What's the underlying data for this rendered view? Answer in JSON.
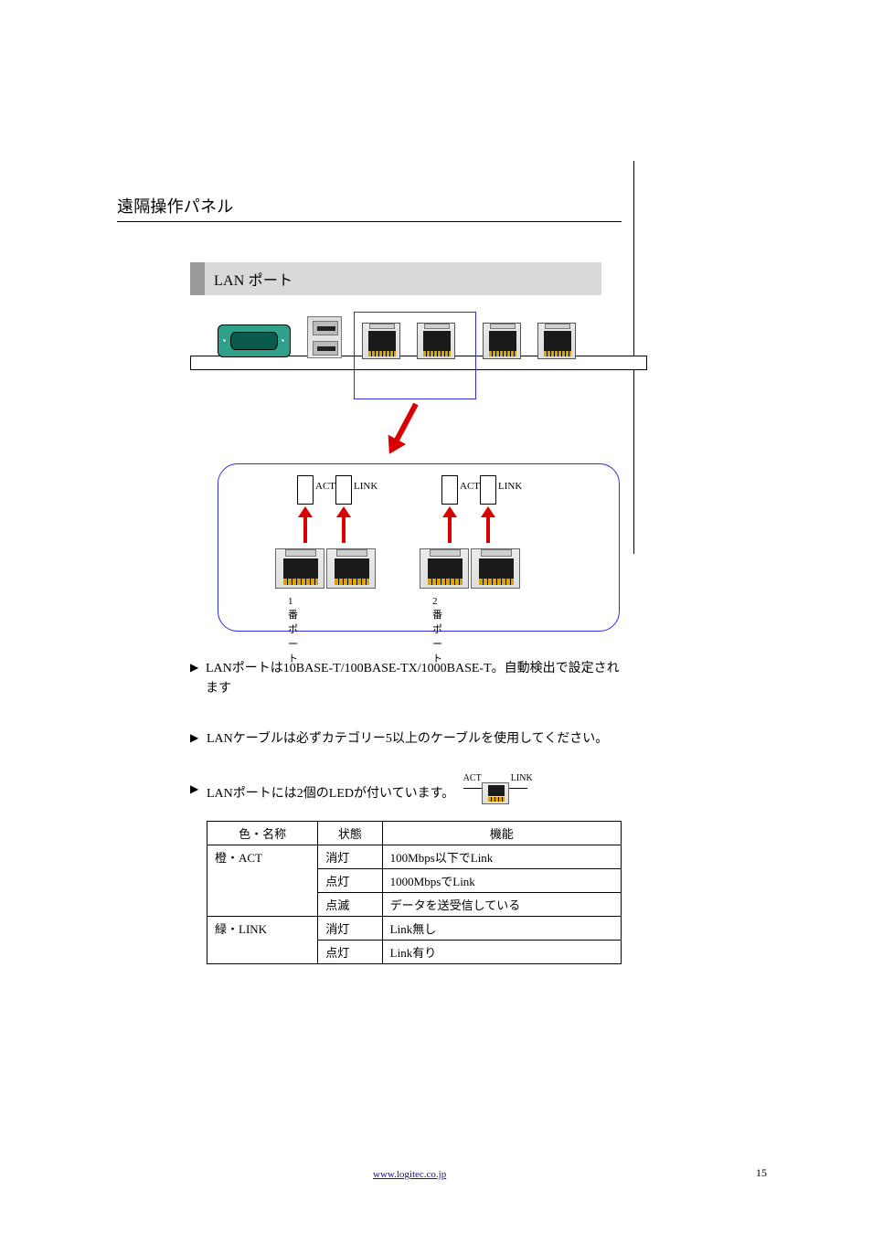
{
  "doc_title": "遠隔操作パネル",
  "section_heading": "LAN ポート",
  "detail": {
    "left_box_left": "ACT",
    "left_box_right": "LINK",
    "right_box_left": "ACT",
    "right_box_right": "LINK",
    "port1_label": "1番ポート",
    "port2_label": "2番ポート"
  },
  "bullets": [
    "LANポートは10BASE-T/100BASE-TX/1000BASE-T。自動検出で設定されます",
    "LANケーブルは必ずカテゴリー5以上のケーブルを使用してください。",
    "LANポートには2個のLEDが付いています。"
  ],
  "lan_fig": {
    "left": "ACT",
    "right": "LINK"
  },
  "table": {
    "headers": [
      "色・名称",
      "状態",
      "機能"
    ],
    "rows": [
      {
        "group": "橙・ACT",
        "cells": [
          {
            "state": "消灯",
            "func": "100Mbps以下でLink"
          },
          {
            "state": "点灯",
            "func": "1000MbpsでLink"
          },
          {
            "state": "点滅",
            "func": "データを送受信している"
          }
        ]
      },
      {
        "group": "緑・LINK",
        "cells": [
          {
            "state": "消灯",
            "func": "Link無し"
          },
          {
            "state": "点灯",
            "func": "Link有り"
          }
        ]
      }
    ]
  },
  "footer_link": "www.logitec.co.jp",
  "page_number": "15"
}
